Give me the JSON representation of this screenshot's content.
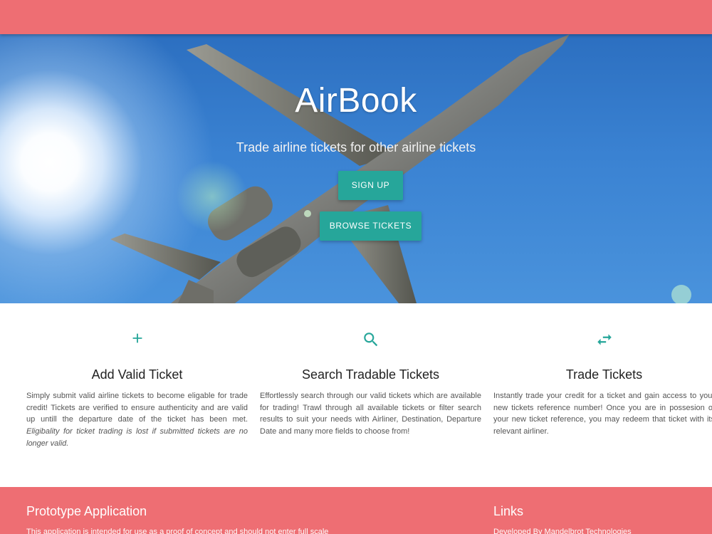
{
  "hero": {
    "title": "AirBook",
    "subtitle": "Trade airline tickets for other airline tickets",
    "signup_label": "SIGN UP",
    "browse_label": "BROWSE TICKETS"
  },
  "features": [
    {
      "icon": "add-icon",
      "title": "Add Valid Ticket",
      "text": "Simply submit valid airline tickets to become eligable for trade credit! Tickets are verified to ensure authenticity and are valid up untill the departure date of the ticket has been met.",
      "note": "Eligibality for ticket trading is lost if submitted tickets are no longer valid."
    },
    {
      "icon": "search-icon",
      "title": "Search Tradable Tickets",
      "text": "Effortlessly search through our valid tickets which are available for trading! Trawl through all available tickets or filter search results to suit your needs with Airliner, Destination, Departure Date and many more fields to choose from!"
    },
    {
      "icon": "swap-icon",
      "title": "Trade Tickets",
      "text": "Instantly trade your credit for a ticket and gain access to your new tickets reference number! Once you are in possesion of your new ticket reference, you may redeem that ticket with its relevant airliner."
    }
  ],
  "footer": {
    "left_title": "Prototype Application",
    "left_text": "This application is intended for use as a proof of concept and should not enter full scale",
    "right_title": "Links",
    "right_text": "Developed By Mandelbrot Technologies"
  },
  "colors": {
    "primary": "#ee6e73",
    "accent": "#26a69a"
  }
}
